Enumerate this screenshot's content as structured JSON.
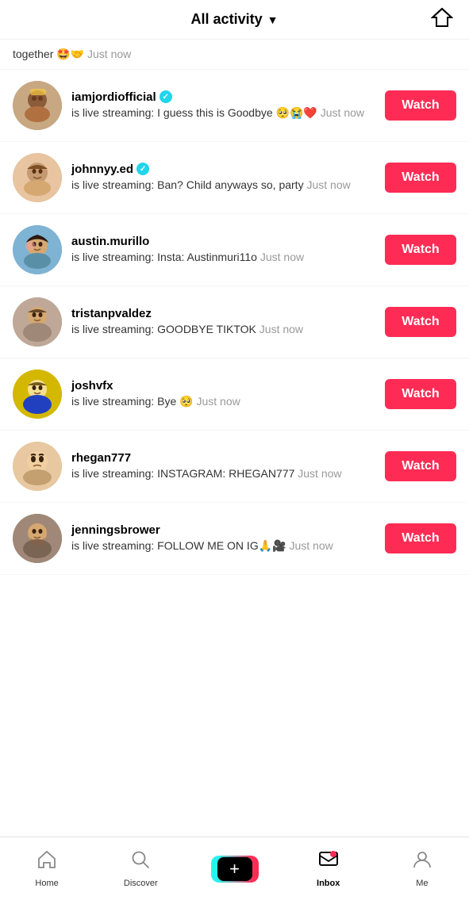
{
  "header": {
    "title": "All activity",
    "title_arrow": "▼",
    "filter_icon": "paper-plane"
  },
  "partial_top": {
    "text": "together 🤩🤝",
    "timestamp": "Just now"
  },
  "activities": [
    {
      "id": "jordi",
      "username": "iamjordiofficial",
      "verified": true,
      "action": "is live streaming: I guess this is Goodbye 🥺😭❤️",
      "timestamp": "Just now",
      "watch_label": "Watch",
      "avatar_class": "avatar-jordi",
      "avatar_emoji": "👩"
    },
    {
      "id": "johnny",
      "username": "johnnyy.ed",
      "verified": true,
      "action": "is live streaming: Ban? Child anyways so, party",
      "timestamp": "Just now",
      "watch_label": "Watch",
      "avatar_class": "avatar-johnny",
      "avatar_emoji": "🧒"
    },
    {
      "id": "austin",
      "username": "austin.murillo",
      "verified": false,
      "action": "is live streaming: Insta: Austinmuri11o",
      "timestamp": "Just now",
      "watch_label": "Watch",
      "avatar_class": "avatar-austin",
      "avatar_emoji": "🧑"
    },
    {
      "id": "tristan",
      "username": "tristanpvaldez",
      "verified": false,
      "action": "is live streaming: GOODBYE TIKTOK",
      "timestamp": "Just now",
      "watch_label": "Watch",
      "avatar_class": "avatar-tristan",
      "avatar_emoji": "👦"
    },
    {
      "id": "josh",
      "username": "joshvfx",
      "verified": false,
      "action": "is live streaming: Bye 🥺",
      "timestamp": "Just now",
      "watch_label": "Watch",
      "avatar_class": "avatar-josh",
      "avatar_emoji": "🧑"
    },
    {
      "id": "rhegan",
      "username": "rhegan777",
      "verified": false,
      "action": "is live streaming: INSTAGRAM: RHEGAN777",
      "timestamp": "Just now",
      "watch_label": "Watch",
      "avatar_class": "avatar-rhegan",
      "avatar_emoji": "🧔"
    },
    {
      "id": "jennings",
      "username": "jenningsbrower",
      "verified": false,
      "action": "is live streaming: FOLLOW ME ON IG🙏🎥",
      "timestamp": "Just now",
      "watch_label": "Watch",
      "avatar_class": "avatar-jennings",
      "avatar_emoji": "👨"
    }
  ],
  "bottom_nav": {
    "items": [
      {
        "id": "home",
        "label": "Home",
        "icon": "home",
        "active": false
      },
      {
        "id": "discover",
        "label": "Discover",
        "icon": "search",
        "active": false
      },
      {
        "id": "create",
        "label": "",
        "icon": "plus",
        "active": false
      },
      {
        "id": "inbox",
        "label": "Inbox",
        "icon": "inbox",
        "active": true
      },
      {
        "id": "me",
        "label": "Me",
        "icon": "person",
        "active": false
      }
    ]
  }
}
